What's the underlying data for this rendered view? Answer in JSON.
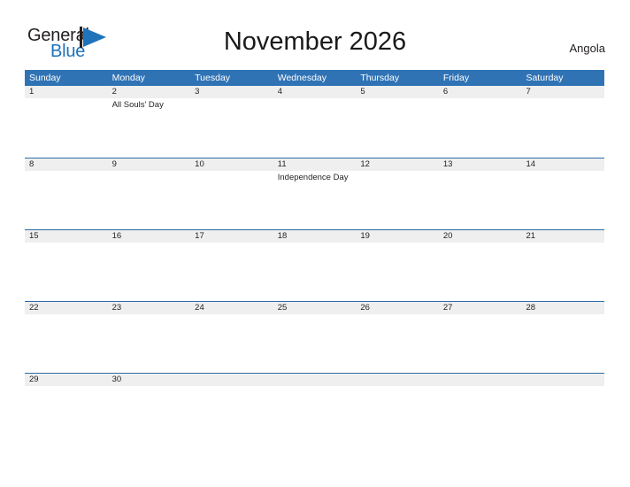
{
  "brand": {
    "name_part1": "General",
    "name_part2": "Blue",
    "flag_icon": "triangle-flag-icon",
    "color_dark": "#231f20",
    "color_blue": "#1f73bb"
  },
  "header": {
    "title": "November 2026",
    "country": "Angola"
  },
  "theme": {
    "header_blue": "#3073b5",
    "row_line_blue": "#2d6ca8",
    "band_gray": "#efefef",
    "text": "#231f20"
  },
  "weekdays": [
    "Sunday",
    "Monday",
    "Tuesday",
    "Wednesday",
    "Thursday",
    "Friday",
    "Saturday"
  ],
  "weeks": [
    {
      "days": [
        {
          "num": "1",
          "events": []
        },
        {
          "num": "2",
          "events": [
            "All Souls’ Day"
          ]
        },
        {
          "num": "3",
          "events": []
        },
        {
          "num": "4",
          "events": []
        },
        {
          "num": "5",
          "events": []
        },
        {
          "num": "6",
          "events": []
        },
        {
          "num": "7",
          "events": []
        }
      ]
    },
    {
      "days": [
        {
          "num": "8",
          "events": []
        },
        {
          "num": "9",
          "events": []
        },
        {
          "num": "10",
          "events": []
        },
        {
          "num": "11",
          "events": [
            "Independence Day"
          ]
        },
        {
          "num": "12",
          "events": []
        },
        {
          "num": "13",
          "events": []
        },
        {
          "num": "14",
          "events": []
        }
      ]
    },
    {
      "days": [
        {
          "num": "15",
          "events": []
        },
        {
          "num": "16",
          "events": []
        },
        {
          "num": "17",
          "events": []
        },
        {
          "num": "18",
          "events": []
        },
        {
          "num": "19",
          "events": []
        },
        {
          "num": "20",
          "events": []
        },
        {
          "num": "21",
          "events": []
        }
      ]
    },
    {
      "days": [
        {
          "num": "22",
          "events": []
        },
        {
          "num": "23",
          "events": []
        },
        {
          "num": "24",
          "events": []
        },
        {
          "num": "25",
          "events": []
        },
        {
          "num": "26",
          "events": []
        },
        {
          "num": "27",
          "events": []
        },
        {
          "num": "28",
          "events": []
        }
      ]
    },
    {
      "last": true,
      "days": [
        {
          "num": "29",
          "events": []
        },
        {
          "num": "30",
          "events": []
        },
        {
          "num": "",
          "events": []
        },
        {
          "num": "",
          "events": []
        },
        {
          "num": "",
          "events": []
        },
        {
          "num": "",
          "events": []
        },
        {
          "num": "",
          "events": []
        }
      ]
    }
  ]
}
